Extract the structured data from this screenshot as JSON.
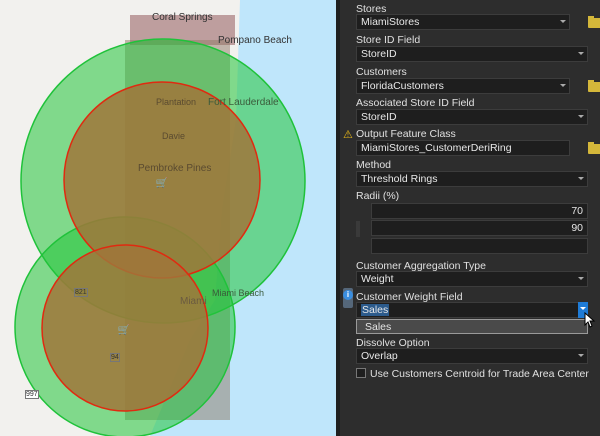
{
  "map": {
    "labels": [
      "Coral Springs",
      "Pompano Beach",
      "Plantation",
      "Fort Lauderdale",
      "Davie",
      "Pembroke Pines",
      "Miami Beach",
      "Miami"
    ],
    "road_shields": [
      "821",
      "94",
      "997"
    ],
    "colors": {
      "ring_outer": "#22c43a",
      "ring_inner": "#e02a10",
      "inner_fill": "#a0763a",
      "water": "#bfe6fb",
      "land": "#f2f1ee",
      "customers": "#8a6a5a"
    }
  },
  "panel": {
    "stores": {
      "label": "Stores",
      "value": "MiamiStores"
    },
    "store_id": {
      "label": "Store ID Field",
      "value": "StoreID"
    },
    "customers": {
      "label": "Customers",
      "value": "FloridaCustomers"
    },
    "assoc_store_id": {
      "label": "Associated Store ID Field",
      "value": "StoreID"
    },
    "output": {
      "label": "Output Feature Class",
      "value": "MiamiStores_CustomerDeriRing",
      "status_icon": "warning-icon"
    },
    "method": {
      "label": "Method",
      "value": "Threshold Rings"
    },
    "radii": {
      "label": "Radii (%)",
      "values": [
        "70",
        "90",
        ""
      ]
    },
    "agg_type": {
      "label": "Customer Aggregation Type",
      "value": "Weight"
    },
    "weight_field": {
      "label": "Customer Weight Field",
      "value": "Sales",
      "options": [
        "Sales"
      ],
      "status_icon": "info-icon"
    },
    "dissolve": {
      "label": "Dissolve Option",
      "value": "Overlap"
    },
    "centroid": {
      "label": "Use Customers Centroid for Trade Area Center",
      "checked": false
    }
  }
}
